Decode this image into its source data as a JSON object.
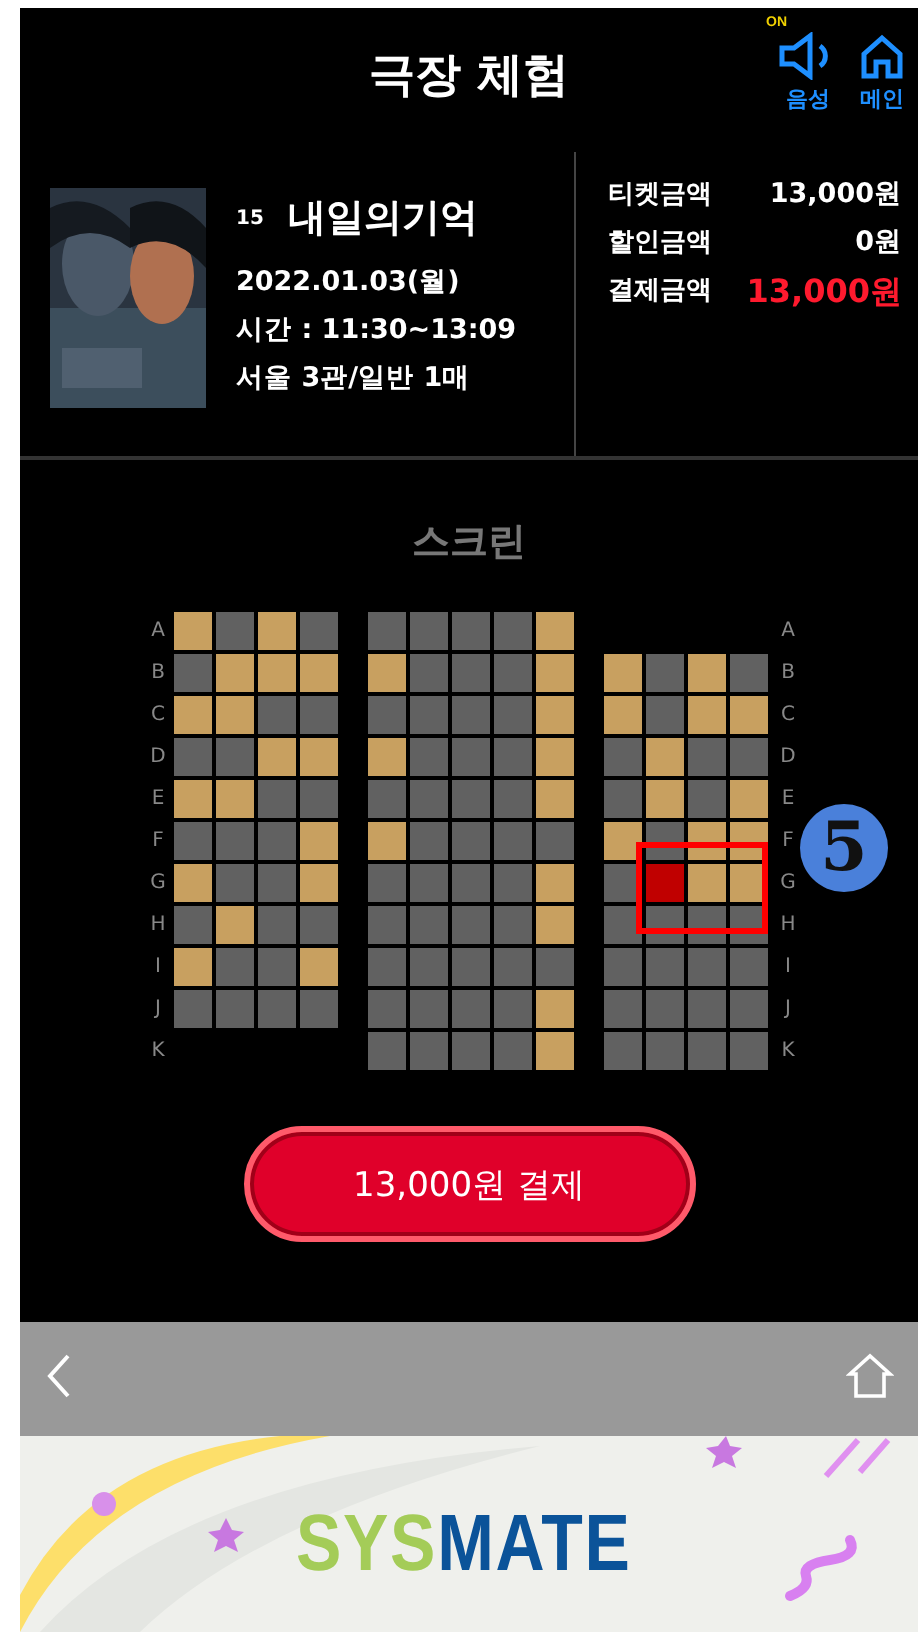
{
  "header": {
    "title": "극장 체험",
    "sound": {
      "badge": "ON",
      "label": "음성",
      "on": true
    },
    "home": {
      "label": "메인"
    }
  },
  "movie": {
    "rating": "15",
    "title": "내일의기억",
    "date": "2022.01.03(월)",
    "time": "시간 : 11:30~13:09",
    "details": "서울 3관/일반 1매"
  },
  "prices": [
    {
      "label": "티켓금액",
      "value": "13,000원",
      "kind": "normal"
    },
    {
      "label": "할인금액",
      "value": "0원",
      "kind": "normal"
    },
    {
      "label": "결제금액",
      "value": "13,000원",
      "kind": "total"
    }
  ],
  "screen_label": "스크린",
  "row_labels_left": [
    "A",
    "B",
    "C",
    "D",
    "E",
    "F",
    "G",
    "H",
    "I",
    "J",
    "K"
  ],
  "row_labels_right": [
    "A",
    "B",
    "C",
    "D",
    "E",
    "F",
    "G",
    "H",
    "I",
    "J",
    "K"
  ],
  "blocks": [
    {
      "rows": [
        {
          "seats": [
            {
              "taken": true,
              "selected": false
            },
            {
              "taken": false,
              "selected": false
            },
            {
              "taken": true,
              "selected": false
            },
            {
              "taken": false,
              "selected": false
            }
          ]
        },
        {
          "seats": [
            {
              "taken": false,
              "selected": false
            },
            {
              "taken": true,
              "selected": false
            },
            {
              "taken": true,
              "selected": false
            },
            {
              "taken": true,
              "selected": false
            }
          ]
        },
        {
          "seats": [
            {
              "taken": true,
              "selected": false
            },
            {
              "taken": true,
              "selected": false
            },
            {
              "taken": false,
              "selected": false
            },
            {
              "taken": false,
              "selected": false
            }
          ]
        },
        {
          "seats": [
            {
              "taken": false,
              "selected": false
            },
            {
              "taken": false,
              "selected": false
            },
            {
              "taken": true,
              "selected": false
            },
            {
              "taken": true,
              "selected": false
            }
          ]
        },
        {
          "seats": [
            {
              "taken": true,
              "selected": false
            },
            {
              "taken": true,
              "selected": false
            },
            {
              "taken": false,
              "selected": false
            },
            {
              "taken": false,
              "selected": false
            }
          ]
        },
        {
          "seats": [
            {
              "taken": false,
              "selected": false
            },
            {
              "taken": false,
              "selected": false
            },
            {
              "taken": false,
              "selected": false
            },
            {
              "taken": true,
              "selected": false
            }
          ]
        },
        {
          "seats": [
            {
              "taken": true,
              "selected": false
            },
            {
              "taken": false,
              "selected": false
            },
            {
              "taken": false,
              "selected": false
            },
            {
              "taken": true,
              "selected": false
            }
          ]
        },
        {
          "seats": [
            {
              "taken": false,
              "selected": false
            },
            {
              "taken": true,
              "selected": false
            },
            {
              "taken": false,
              "selected": false
            },
            {
              "taken": false,
              "selected": false
            }
          ]
        },
        {
          "seats": [
            {
              "taken": true,
              "selected": false
            },
            {
              "taken": false,
              "selected": false
            },
            {
              "taken": false,
              "selected": false
            },
            {
              "taken": true,
              "selected": false
            }
          ]
        },
        {
          "seats": [
            {
              "taken": false,
              "selected": false
            },
            {
              "taken": false,
              "selected": false
            },
            {
              "taken": false,
              "selected": false
            },
            {
              "taken": false,
              "selected": false
            }
          ]
        },
        {
          "seats": []
        }
      ]
    },
    {
      "rows": [
        {
          "seats": [
            {
              "taken": false,
              "selected": false
            },
            {
              "taken": false,
              "selected": false
            },
            {
              "taken": false,
              "selected": false
            },
            {
              "taken": false,
              "selected": false
            },
            {
              "taken": true,
              "selected": false
            }
          ]
        },
        {
          "seats": [
            {
              "taken": true,
              "selected": false
            },
            {
              "taken": false,
              "selected": false
            },
            {
              "taken": false,
              "selected": false
            },
            {
              "taken": false,
              "selected": false
            },
            {
              "taken": true,
              "selected": false
            }
          ]
        },
        {
          "seats": [
            {
              "taken": false,
              "selected": false
            },
            {
              "taken": false,
              "selected": false
            },
            {
              "taken": false,
              "selected": false
            },
            {
              "taken": false,
              "selected": false
            },
            {
              "taken": true,
              "selected": false
            }
          ]
        },
        {
          "seats": [
            {
              "taken": true,
              "selected": false
            },
            {
              "taken": false,
              "selected": false
            },
            {
              "taken": false,
              "selected": false
            },
            {
              "taken": false,
              "selected": false
            },
            {
              "taken": true,
              "selected": false
            }
          ]
        },
        {
          "seats": [
            {
              "taken": false,
              "selected": false
            },
            {
              "taken": false,
              "selected": false
            },
            {
              "taken": false,
              "selected": false
            },
            {
              "taken": false,
              "selected": false
            },
            {
              "taken": true,
              "selected": false
            }
          ]
        },
        {
          "seats": [
            {
              "taken": true,
              "selected": false
            },
            {
              "taken": false,
              "selected": false
            },
            {
              "taken": false,
              "selected": false
            },
            {
              "taken": false,
              "selected": false
            },
            {
              "taken": false,
              "selected": false
            }
          ]
        },
        {
          "seats": [
            {
              "taken": false,
              "selected": false
            },
            {
              "taken": false,
              "selected": false
            },
            {
              "taken": false,
              "selected": false
            },
            {
              "taken": false,
              "selected": false
            },
            {
              "taken": true,
              "selected": false
            }
          ]
        },
        {
          "seats": [
            {
              "taken": false,
              "selected": false
            },
            {
              "taken": false,
              "selected": false
            },
            {
              "taken": false,
              "selected": false
            },
            {
              "taken": false,
              "selected": false
            },
            {
              "taken": true,
              "selected": false
            }
          ]
        },
        {
          "seats": [
            {
              "taken": false,
              "selected": false
            },
            {
              "taken": false,
              "selected": false
            },
            {
              "taken": false,
              "selected": false
            },
            {
              "taken": false,
              "selected": false
            },
            {
              "taken": false,
              "selected": false
            }
          ]
        },
        {
          "seats": [
            {
              "taken": false,
              "selected": false
            },
            {
              "taken": false,
              "selected": false
            },
            {
              "taken": false,
              "selected": false
            },
            {
              "taken": false,
              "selected": false
            },
            {
              "taken": true,
              "selected": false
            }
          ]
        },
        {
          "seats": [
            {
              "taken": false,
              "selected": false
            },
            {
              "taken": false,
              "selected": false
            },
            {
              "taken": false,
              "selected": false
            },
            {
              "taken": false,
              "selected": false
            },
            {
              "taken": true,
              "selected": false
            }
          ]
        }
      ]
    },
    {
      "rows": [
        {
          "seats": []
        },
        {
          "seats": [
            {
              "taken": true,
              "selected": false
            },
            {
              "taken": false,
              "selected": false
            },
            {
              "taken": true,
              "selected": false
            },
            {
              "taken": false,
              "selected": false
            }
          ]
        },
        {
          "seats": [
            {
              "taken": true,
              "selected": false
            },
            {
              "taken": false,
              "selected": false
            },
            {
              "taken": true,
              "selected": false
            },
            {
              "taken": true,
              "selected": false
            }
          ]
        },
        {
          "seats": [
            {
              "taken": false,
              "selected": false
            },
            {
              "taken": true,
              "selected": false
            },
            {
              "taken": false,
              "selected": false
            },
            {
              "taken": false,
              "selected": false
            }
          ]
        },
        {
          "seats": [
            {
              "taken": false,
              "selected": false
            },
            {
              "taken": true,
              "selected": false
            },
            {
              "taken": false,
              "selected": false
            },
            {
              "taken": true,
              "selected": false
            }
          ]
        },
        {
          "seats": [
            {
              "taken": true,
              "selected": false
            },
            {
              "taken": false,
              "selected": false
            },
            {
              "taken": true,
              "selected": false
            },
            {
              "taken": true,
              "selected": false
            }
          ]
        },
        {
          "seats": [
            {
              "taken": false,
              "selected": false
            },
            {
              "selected": true
            },
            {
              "taken": true,
              "selected": false
            },
            {
              "taken": true,
              "selected": false
            }
          ]
        },
        {
          "seats": [
            {
              "taken": false,
              "selected": false
            },
            {
              "taken": false,
              "selected": false
            },
            {
              "taken": false,
              "selected": false
            },
            {
              "taken": false,
              "selected": false
            }
          ]
        },
        {
          "seats": [
            {
              "taken": false,
              "selected": false
            },
            {
              "taken": false,
              "selected": false
            },
            {
              "taken": false,
              "selected": false
            },
            {
              "taken": false,
              "selected": false
            }
          ]
        },
        {
          "seats": [
            {
              "taken": false,
              "selected": false
            },
            {
              "taken": false,
              "selected": false
            },
            {
              "taken": false,
              "selected": false
            },
            {
              "taken": false,
              "selected": false
            }
          ]
        },
        {
          "seats": [
            {
              "taken": false,
              "selected": false
            },
            {
              "taken": false,
              "selected": false
            },
            {
              "taken": false,
              "selected": false
            },
            {
              "taken": false,
              "selected": false
            }
          ]
        }
      ]
    }
  ],
  "callout": {
    "number": "5"
  },
  "pay_button": "13,000원 결제",
  "banner": {
    "logo": [
      "SYS",
      "MATE"
    ]
  }
}
